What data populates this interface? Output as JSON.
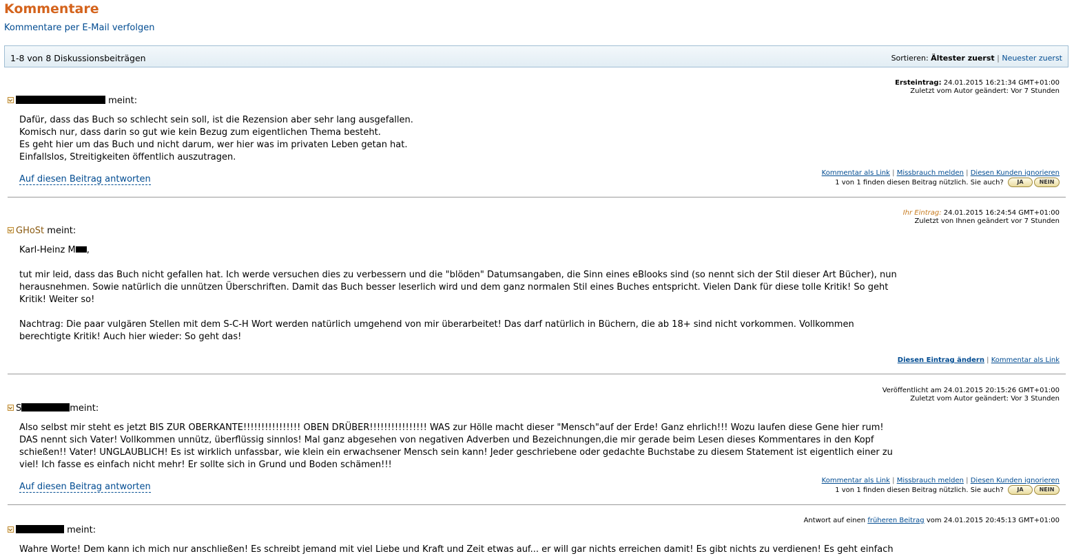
{
  "header": {
    "title": "Kommentare",
    "follow_link": "Kommentare per E-Mail verfolgen"
  },
  "bar": {
    "count": "1-8 von 8 Diskussionsbeiträgen",
    "sort_label": "Sortieren:",
    "sort_active": "Ältester zuerst",
    "sort_sep": "|",
    "sort_other": "Neuester zuerst"
  },
  "common": {
    "meint": "meint:",
    "reply": "Auf diesen Beitrag antworten",
    "link_comment": "Kommentar als Link",
    "link_abuse": "Missbrauch melden",
    "link_ignore": "Diesen Kunden ignorieren",
    "link_edit": "Diesen Eintrag ändern",
    "sep": "|",
    "helpful_q": "1 von 1 finden diesen Beitrag nützlich. Sie auch?",
    "ja": "JA",
    "nein": "NEIN"
  },
  "posts": [
    {
      "meta_label": "Ersteintrag:",
      "meta_date": "24.01.2015 16:21:34 GMT+01:00",
      "meta_line2": "Zuletzt vom Autor geändert: Vor 7 Stunden",
      "body": "Dafür, dass das Buch so schlecht sein soll, ist die Rezension aber sehr lang ausgefallen.\nKomisch nur, dass darin so gut wie kein Bezug zum eigentlichen Thema besteht.\nEs geht hier um das Buch und nicht darum, wer hier was im privaten Leben getan hat.\nEinfallslos, Streitigkeiten öffentlich auszutragen."
    },
    {
      "meta_label": "Ihr Eintrag:",
      "meta_date": "24.01.2015 16:24:54 GMT+01:00",
      "meta_line2": "Zuletzt von Ihnen geändert vor 7 Stunden",
      "author": "GHoSt",
      "salutation": "Karl-Heinz M",
      "salutation_end": ",",
      "body": "tut mir leid, dass das Buch nicht gefallen hat. Ich werde versuchen dies zu verbessern und die \"blöden\" Datumsangaben, die Sinn eines eBlooks sind (so nennt sich der Stil dieser Art Bücher), nun herausnehmen. Sowie natürlich die unnützen Überschriften. Damit das Buch besser leserlich wird und dem ganz normalen Stil eines Buches entspricht. Vielen Dank für diese tolle Kritik! So geht Kritik! Weiter so!\n\nNachtrag: Die paar vulgären Stellen mit dem S-C-H Wort werden natürlich umgehend von mir überarbeitet! Das darf natürlich in Büchern, die ab 18+ sind nicht vorkommen. Vollkommen berechtigte Kritik! Auch hier wieder: So geht das!"
    },
    {
      "meta_date_full": "Veröffentlicht am 24.01.2015 20:15:26 GMT+01:00",
      "meta_line2": "Zuletzt vom Autor geändert: Vor 3 Stunden",
      "author_initial": "S",
      "body": "Also selbst mir steht es jetzt BIS ZUR OBERKANTE!!!!!!!!!!!!!!!! OBEN DRÜBER!!!!!!!!!!!!!!!! WAS zur Hölle macht dieser \"Mensch\"auf der Erde! Ganz ehrlich!!! Wozu laufen diese Gene hier rum! DAS nennt sich Vater! Vollkommen unnütz, überflüssig sinnlos! Mal ganz abgesehen von negativen Adverben und Bezeichnungen,die mir gerade beim Lesen dieses Kommentares in den Kopf schießen!! Vater! UNGLAUBLICH! Es ist wirklich unfassbar, wie klein ein erwachsener Mensch sein kann! Jeder geschriebene oder gedachte Buchstabe zu diesem Statement ist eigentlich einer zu viel! Ich fasse es einfach nicht mehr! Er sollte sich in Grund und Boden schämen!!!"
    },
    {
      "meta_prefix": "Antwort auf einen",
      "meta_link": "früheren Beitrag",
      "meta_suffix": "vom 24.01.2015 20:45:13 GMT+01:00",
      "body": "Wahre Worte! Dem kann ich mich nur anschließen! Es schreibt jemand mit viel Liebe und Kraft und Zeit etwas auf... er will gar nichts erreichen damit! Es gibt nichts zu verdienen! Es geht einfach"
    }
  ]
}
